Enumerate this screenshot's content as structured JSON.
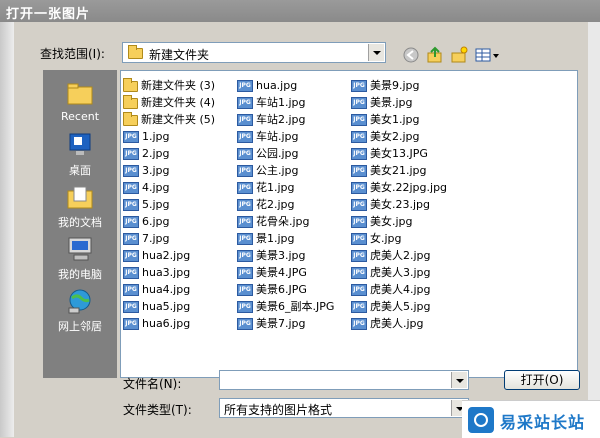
{
  "window": {
    "title": "打开一张图片"
  },
  "look_in": {
    "label": "查找范围(I):",
    "value": "新建文件夹"
  },
  "places": [
    {
      "label": "Recent",
      "icon": "recent-folder-icon"
    },
    {
      "label": "桌面",
      "icon": "desktop-icon"
    },
    {
      "label": "我的文档",
      "icon": "my-documents-icon"
    },
    {
      "label": "我的电脑",
      "icon": "my-computer-icon"
    },
    {
      "label": "网上邻居",
      "icon": "network-places-icon"
    }
  ],
  "files": {
    "col1": [
      {
        "name": "新建文件夹 (3)",
        "type": "folder"
      },
      {
        "name": "新建文件夹 (4)",
        "type": "folder"
      },
      {
        "name": "新建文件夹 (5)",
        "type": "folder"
      },
      {
        "name": "1.jpg",
        "type": "jpg"
      },
      {
        "name": "2.jpg",
        "type": "jpg"
      },
      {
        "name": "3.jpg",
        "type": "jpg"
      },
      {
        "name": "4.jpg",
        "type": "jpg"
      },
      {
        "name": "5.jpg",
        "type": "jpg"
      },
      {
        "name": "6.jpg",
        "type": "jpg"
      },
      {
        "name": "7.jpg",
        "type": "jpg"
      },
      {
        "name": "hua2.jpg",
        "type": "jpg"
      },
      {
        "name": "hua3.jpg",
        "type": "jpg"
      },
      {
        "name": "hua4.jpg",
        "type": "jpg"
      },
      {
        "name": "hua5.jpg",
        "type": "jpg"
      },
      {
        "name": "hua6.jpg",
        "type": "jpg"
      }
    ],
    "col2": [
      {
        "name": "hua.jpg",
        "type": "jpg"
      },
      {
        "name": "车站1.jpg",
        "type": "jpg"
      },
      {
        "name": "车站2.jpg",
        "type": "jpg"
      },
      {
        "name": "车站.jpg",
        "type": "jpg"
      },
      {
        "name": "公园.jpg",
        "type": "jpg"
      },
      {
        "name": "公主.jpg",
        "type": "jpg"
      },
      {
        "name": "花1.jpg",
        "type": "jpg"
      },
      {
        "name": "花2.jpg",
        "type": "jpg"
      },
      {
        "name": "花骨朵.jpg",
        "type": "jpg"
      },
      {
        "name": "景1.jpg",
        "type": "jpg"
      },
      {
        "name": "美景3.jpg",
        "type": "jpg"
      },
      {
        "name": "美景4.JPG",
        "type": "jpg"
      },
      {
        "name": "美景6.JPG",
        "type": "jpg"
      },
      {
        "name": "美景6_副本.JPG",
        "type": "jpg"
      },
      {
        "name": "美景7.jpg",
        "type": "jpg"
      }
    ],
    "col3": [
      {
        "name": "美景9.jpg",
        "type": "jpg"
      },
      {
        "name": "美景.jpg",
        "type": "jpg"
      },
      {
        "name": "美女1.jpg",
        "type": "jpg"
      },
      {
        "name": "美女2.jpg",
        "type": "jpg"
      },
      {
        "name": "美女13.JPG",
        "type": "jpg"
      },
      {
        "name": "美女21.jpg",
        "type": "jpg"
      },
      {
        "name": "美女.22jpg.jpg",
        "type": "jpg"
      },
      {
        "name": "美女.23.jpg",
        "type": "jpg"
      },
      {
        "name": "美女.jpg",
        "type": "jpg"
      },
      {
        "name": "女.jpg",
        "type": "jpg"
      },
      {
        "name": "虎美人2.jpg",
        "type": "jpg"
      },
      {
        "name": "虎美人3.jpg",
        "type": "jpg"
      },
      {
        "name": "虎美人4.jpg",
        "type": "jpg"
      },
      {
        "name": "虎美人5.jpg",
        "type": "jpg"
      },
      {
        "name": "虎美人.jpg",
        "type": "jpg"
      }
    ]
  },
  "filename": {
    "label": "文件名(N):",
    "value": ""
  },
  "filetype": {
    "label": "文件类型(T):",
    "value": "所有支持的图片格式"
  },
  "buttons": {
    "open": "打开(O)"
  },
  "watermark": {
    "text": "易采站长站"
  },
  "colors": {
    "title_bar": "#8f8f8f",
    "dialog_bg": "#d4d0c8",
    "places_bar": "#808080",
    "jpg_icon": "#5a8fd0",
    "folder_icon": "#f6cf5b"
  }
}
